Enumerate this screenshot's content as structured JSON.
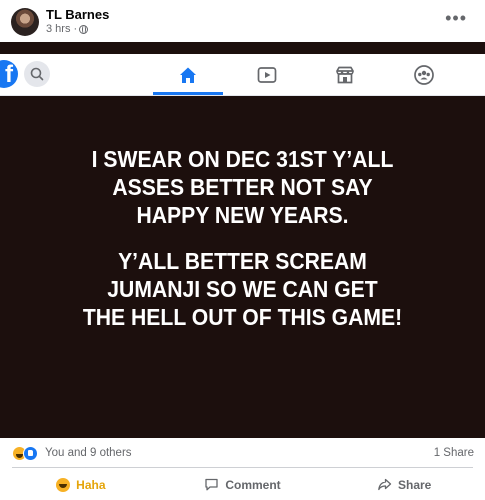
{
  "post": {
    "author": "TL Barnes",
    "time": "3 hrs ·"
  },
  "screenshot": {
    "nav_logo": "f",
    "meme_line_1": "I SWEAR ON DEC 31ST Y'ALL ASSES BETTER NOT SAY HAPPY NEW YEARS.",
    "meme_line_2": "Y'ALL BETTER SCREAM JUMANJI SO WE CAN GET THE HELL OUT OF THIS GAME!",
    "meme_line_1a": "I SWEAR ON DEC 31ST Y’ALL",
    "meme_line_1b": "ASSES BETTER NOT SAY",
    "meme_line_1c": "HAPPY NEW YEARS.",
    "meme_line_2a": "Y’ALL BETTER SCREAM",
    "meme_line_2b": "JUMANJI SO WE CAN GET",
    "meme_line_2c": "THE HELL OUT OF THIS GAME!"
  },
  "summary": {
    "reactions_text": "You and 9 others",
    "shares_text": "1 Share"
  },
  "actions": {
    "react_label": "Haha",
    "comment_label": "Comment",
    "share_label": "Share"
  },
  "colors": {
    "fb_blue": "#1877f2",
    "haha_yellow": "#f7b125",
    "meme_bg": "#1c0f0d"
  },
  "icons": [
    "avatar",
    "globe-icon",
    "more-icon",
    "facebook-logo-icon",
    "search-icon",
    "home-icon",
    "watch-icon",
    "marketplace-icon",
    "groups-icon",
    "haha-reaction-icon",
    "like-reaction-icon",
    "comment-icon",
    "share-icon"
  ]
}
